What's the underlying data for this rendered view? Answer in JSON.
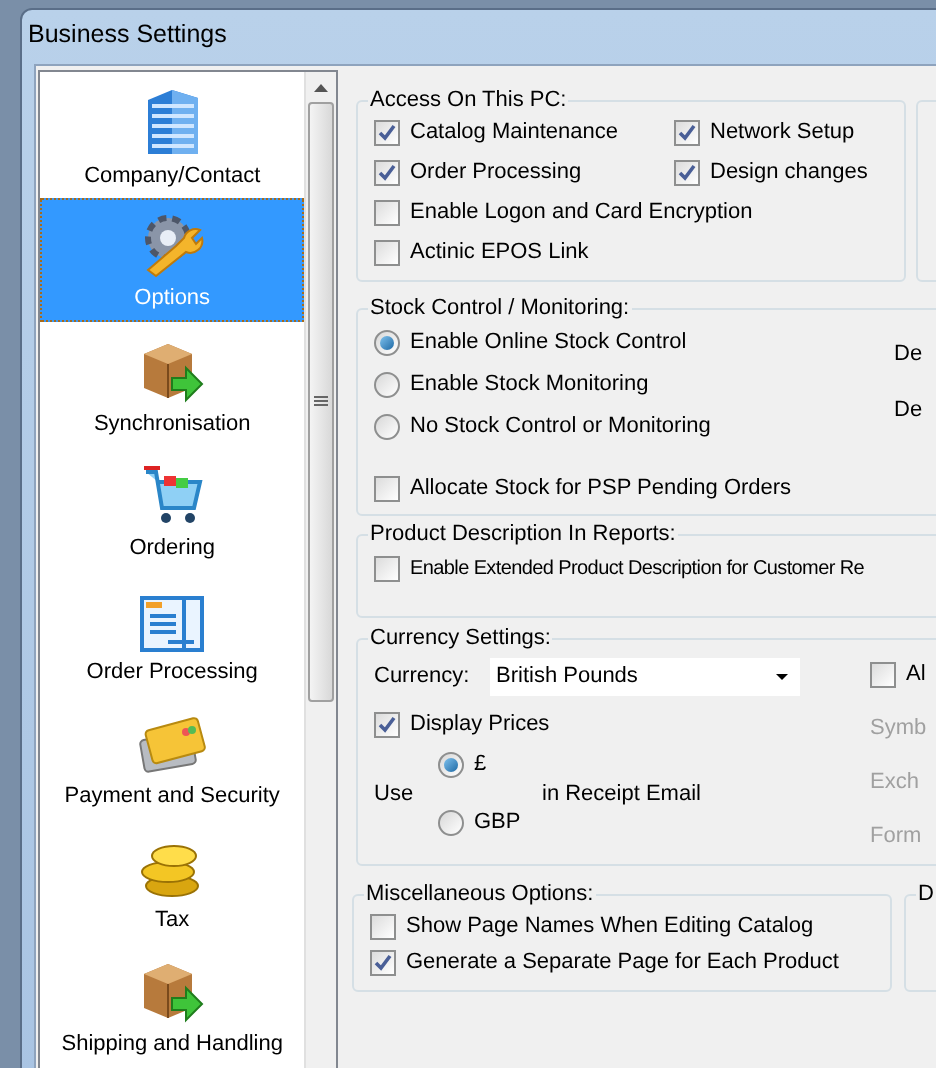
{
  "window": {
    "title": "Business Settings"
  },
  "sidebar": {
    "items": [
      {
        "kind": "building",
        "label": "Company/Contact",
        "selected": false
      },
      {
        "kind": "gear",
        "label": "Options",
        "selected": true
      },
      {
        "kind": "box",
        "label": "Synchronisation",
        "selected": false
      },
      {
        "kind": "cart",
        "label": "Ordering",
        "selected": false
      },
      {
        "kind": "form",
        "label": "Order Processing",
        "selected": false
      },
      {
        "kind": "cards",
        "label": "Payment and Security",
        "selected": false
      },
      {
        "kind": "coins",
        "label": "Tax",
        "selected": false
      },
      {
        "kind": "box",
        "label": "Shipping and Handling",
        "selected": false
      }
    ]
  },
  "access": {
    "title": "Access On This PC:",
    "options": [
      {
        "label": "Catalog Maintenance",
        "checked": true
      },
      {
        "label": "Network Setup",
        "checked": true
      },
      {
        "label": "Order Processing",
        "checked": true
      },
      {
        "label": "Design changes",
        "checked": true
      },
      {
        "label": "Enable Logon and Card Encryption",
        "checked": false
      },
      {
        "label": "Actinic EPOS Link",
        "checked": false
      }
    ]
  },
  "stock": {
    "title": "Stock Control / Monitoring:",
    "modes": [
      {
        "label": "Enable Online Stock Control",
        "selected": true
      },
      {
        "label": "Enable Stock Monitoring",
        "selected": false
      },
      {
        "label": "No Stock Control  or Monitoring",
        "selected": false
      }
    ],
    "side_labels": [
      "De",
      "De"
    ],
    "allocate": {
      "label": "Allocate Stock for PSP Pending Orders",
      "checked": false
    }
  },
  "product_description": {
    "title": "Product Description In Reports:",
    "option": {
      "label": "Enable Extended Product Description for Customer Re",
      "checked": false
    }
  },
  "currency": {
    "title": "Currency Settings:",
    "currency_label": "Currency:",
    "currency_value": "British Pounds",
    "display_prices": {
      "label": "Display Prices",
      "checked": true
    },
    "use_label": "Use",
    "receipt_label": "in Receipt Email",
    "symbols": [
      {
        "label": "£",
        "selected": true
      },
      {
        "label": "GBP",
        "selected": false
      }
    ],
    "side_check": {
      "label": "Al",
      "checked": false
    },
    "side_labels": [
      "Symb",
      "Exch",
      "Form"
    ]
  },
  "misc": {
    "title": "Miscellaneous Options:",
    "options": [
      {
        "label": "Show Page Names When Editing Catalog",
        "checked": false
      },
      {
        "label": "Generate a Separate Page for Each Product",
        "checked": true
      }
    ]
  },
  "side_group": {
    "title": "D"
  }
}
